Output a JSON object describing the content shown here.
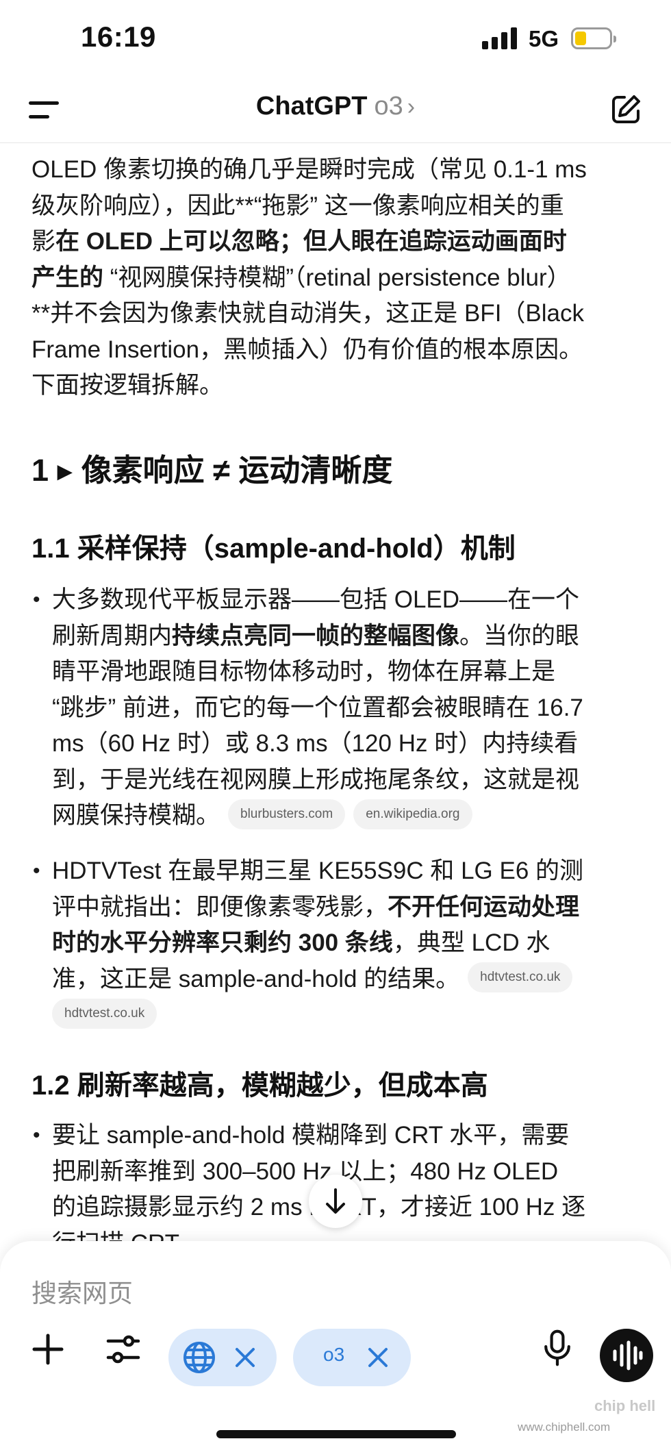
{
  "status_bar": {
    "time": "16:19",
    "network": "5G"
  },
  "header": {
    "title": "ChatGPT",
    "model": "o3",
    "chevron": "›"
  },
  "content": {
    "intro": {
      "l1": "OLED 像素切换的确几乎是瞬时完成（常见 0.1-1 ms",
      "l2": "级灰阶响应），因此**“拖影” 这一像素响应相关的重",
      "l3a": "影",
      "l3b": "在 OLED 上可以忽略；但人眼在追踪运动画面时",
      "l4a": "产生的",
      "l4b": " “视网膜保持模糊”（retinal persistence blur）",
      "l5": "**并不会因为像素快就自动消失，这正是 BFI（Black",
      "l6": "Frame Insertion，黑帧插入）仍有价值的根本原因。",
      "l7": "下面按逻辑拆解。"
    },
    "h1": "1 ▸ 像素响应 ≠ 运动清晰度",
    "h1_1": "1.1 采样保持（sample-and-hold）机制",
    "bullet1": {
      "l1": "大多数现代平板显示器——包括 OLED——在一个",
      "l2a": "刷新周期内",
      "l2b": "持续点亮同一帧的整幅图像",
      "l2c": "。当你的眼",
      "l3": "睛平滑地跟随目标物体移动时，物体在屏幕上是",
      "l4": "“跳步” 前进，而它的每一个位置都会被眼睛在 16.7",
      "l5": "ms（60 Hz 时）或 8.3 ms（120 Hz 时）内持续看",
      "l6": "到，于是光线在视网膜上形成拖尾条纹，这就是视",
      "l7": "网膜保持模糊。",
      "chips": [
        "blurbusters.com",
        "en.wikipedia.org"
      ]
    },
    "bullet2": {
      "l1": "HDTVTest 在最早期三星 KE55S9C 和 LG E6 的测",
      "l2a": "评中就指出：即便像素零残影，",
      "l2b": "不开任何运动处理",
      "l3a": "时的水平分辨率只剩约 300 条线",
      "l3b": "，典型 LCD 水",
      "l4": "准，这正是 sample-and-hold 的结果。",
      "chips": [
        "hdtvtest.co.uk",
        "hdtvtest.co.uk"
      ]
    },
    "h1_2": "1.2 刷新率越高，模糊越少，但成本高",
    "bullet3": {
      "l1": "要让 sample-and-hold 模糊降到 CRT 水平，需要",
      "l2": "把刷新率推到 300–500 Hz 以上；480 Hz OLED",
      "l3": "的追踪摄影显示约 2 ms MPRT，才接近 100 Hz 逐",
      "l4": "行扫描 CRT。"
    }
  },
  "composer": {
    "placeholder": "搜索网页",
    "model_pill": "o3"
  },
  "watermark": {
    "site": "www.chiphell.com",
    "logo": "chip hell"
  },
  "icons": [
    "menu-icon",
    "edit-icon",
    "chevron-right-icon",
    "arrow-down-icon",
    "plus-icon",
    "sliders-icon",
    "globe-icon",
    "close-icon",
    "mic-icon",
    "voice-waveform-icon",
    "signal-icon",
    "battery-icon"
  ],
  "colors": {
    "pill_bg": "#dbe9fb",
    "pill_fg": "#2a79d6",
    "battery_fill": "#f5c800",
    "chip_bg": "#f2f2f2"
  }
}
